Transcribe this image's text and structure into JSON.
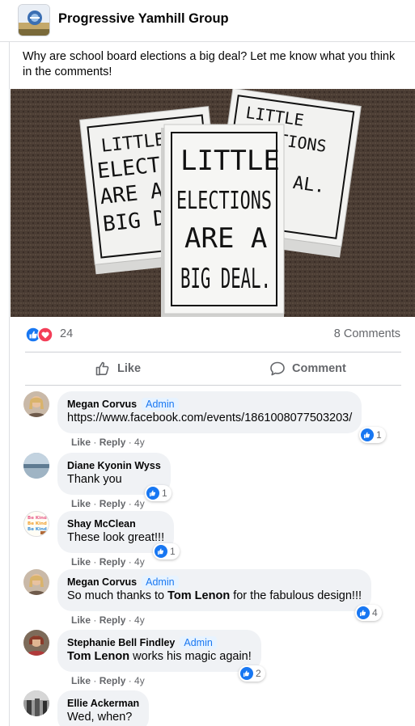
{
  "group": {
    "title": "Progressive Yamhill Group"
  },
  "post": {
    "text": "Why are school board elections a big deal?  Let me know what you think in the comments!",
    "photo": {
      "card_line1": "LITTLE",
      "card_line2": "ELECTIONS",
      "card_line3": "ARE A",
      "card_line4": "BIG DEAL.",
      "left_line1": "LITTLE",
      "left_line2": "ELECTI",
      "left_line3": "ARE A",
      "left_line4": "BIG DEA",
      "right_line1": "LITTLE",
      "right_line2": "ELECTIONS",
      "right_line3": "AL."
    },
    "reaction_count": "24",
    "comments_count": "8 Comments"
  },
  "actions": {
    "like_label": "Like",
    "comment_label": "Comment"
  },
  "colors": {
    "accent": "#1877f2",
    "love": "#f33e58",
    "bubble": "#f0f2f5",
    "meta": "#65676b"
  },
  "comments": [
    {
      "name": "Megan Corvus",
      "badge": "Admin",
      "text": "https://www.facebook.com/events/1861008077503203/",
      "like": "Like",
      "reply": "Reply",
      "time": "4y",
      "reactions": "1"
    },
    {
      "name": "Diane Kyonin Wyss",
      "text": "Thank you",
      "like": "Like",
      "reply": "Reply",
      "time": "4y",
      "reactions": "1"
    },
    {
      "name": "Shay McClean",
      "avatar_text": "Be Kind",
      "text": "These look great!!!",
      "like": "Like",
      "reply": "Reply",
      "time": "4y",
      "reactions": "1"
    },
    {
      "name": "Megan Corvus",
      "badge": "Admin",
      "text_a": "So much thanks to ",
      "text_b": "Tom Lenon",
      "text_c": " for the fabulous design!!!",
      "like": "Like",
      "reply": "Reply",
      "time": "4y",
      "reactions": "4"
    },
    {
      "name": "Stephanie Bell Findley",
      "badge": "Admin",
      "text_b": "Tom Lenon",
      "text_c": " works his magic again!",
      "like": "Like",
      "reply": "Reply",
      "time": "4y",
      "reactions": "2"
    },
    {
      "name": "Ellie Ackerman",
      "text": "Wed, when?"
    }
  ]
}
